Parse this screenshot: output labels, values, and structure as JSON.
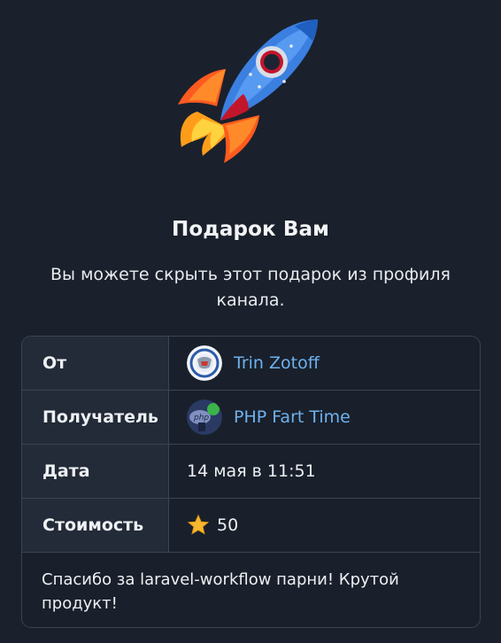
{
  "gift": {
    "title": "Подарок Вам",
    "subtitle": "Вы можете скрыть этот подарок из профиля канала.",
    "emoji": "rocket-icon"
  },
  "table": {
    "from": {
      "label": "От",
      "value": "Trin Zotoff",
      "avatar": "emblem-avatar"
    },
    "recipient": {
      "label": "Получатель",
      "value": "PHP Fart Time",
      "avatar": "php-avatar"
    },
    "date": {
      "label": "Дата",
      "value": "14 мая в 11:51"
    },
    "cost": {
      "label": "Стоимость",
      "value": "50",
      "icon": "star-icon"
    },
    "comment": "Спасибо за laravel-workflow парни! Крутой продукт!"
  },
  "colors": {
    "background": "#1a212c",
    "label_cell": "#222b37",
    "border": "#3a4453",
    "link": "#6fb1ee"
  }
}
